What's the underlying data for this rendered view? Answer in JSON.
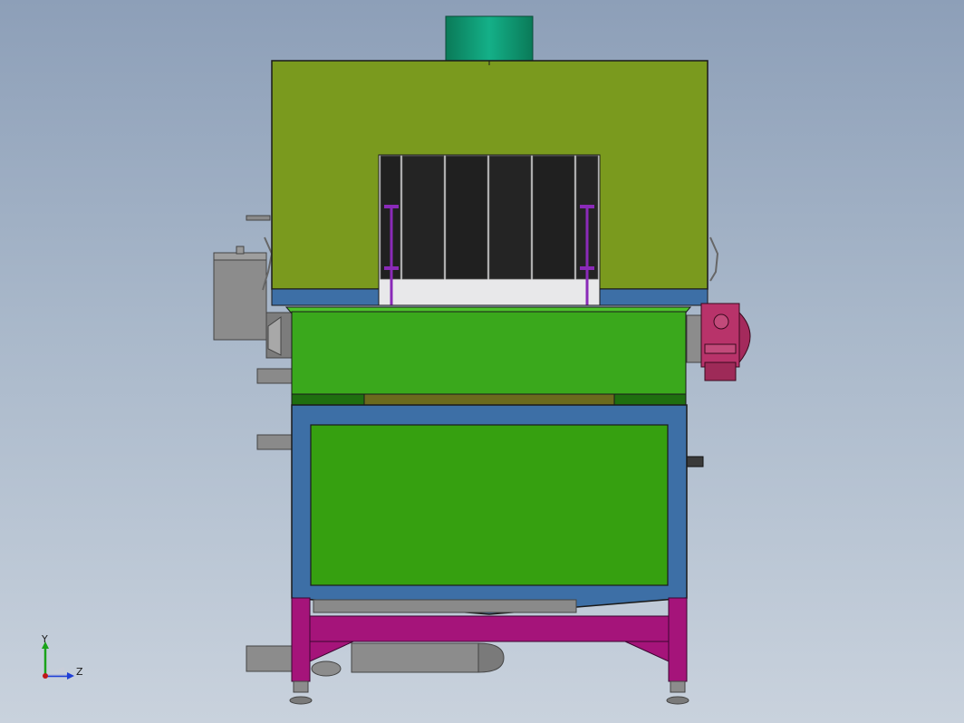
{
  "window": {
    "view_name": ""
  },
  "triad": {
    "y_label": "Y",
    "z_label": "Z",
    "y_color": "#1aa31a",
    "z_color": "#1f3fd6",
    "origin_color": "#c01818"
  },
  "colors": {
    "background_top": "#8d9fb8",
    "background_bottom": "#c9d2dd",
    "hood": "#7a9a1e",
    "fan_housing": "#0f9a72",
    "conveyor_panel": "#3aa81c",
    "tank_panel": "#36a010",
    "frame_blue": "#3d6fa6",
    "stand_magenta": "#a5147a",
    "motor": "#b8336a",
    "gray_parts": "#8c8c8c",
    "curtain": "#222222",
    "rods": "#8a2ab8"
  }
}
